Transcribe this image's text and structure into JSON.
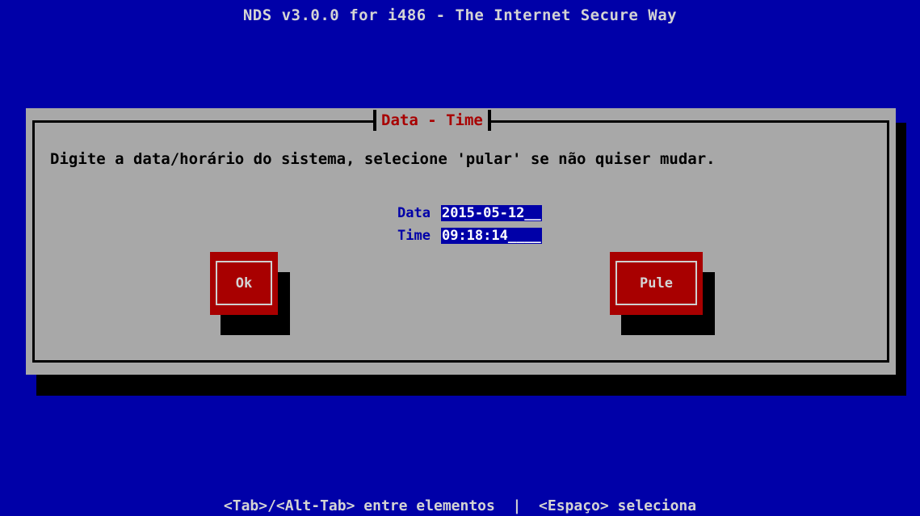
{
  "header": {
    "title": "NDS v3.0.0 for i486 - The Internet Secure Way"
  },
  "dialog": {
    "title": "Data - Time",
    "message": "Digite a data/horário do sistema, selecione 'pular' se não quiser mudar.",
    "fields": [
      {
        "label": "Data",
        "value": "2015-05-12__"
      },
      {
        "label": "Time",
        "value": "09:18:14____"
      }
    ],
    "buttons": {
      "ok_label": "Ok",
      "skip_label": "Pule"
    }
  },
  "footer": {
    "hint": "<Tab>/<Alt-Tab> entre elementos  |  <Espaço> seleciona"
  },
  "colors": {
    "screen_background": "#0000a8",
    "dialog_background": "#a8a8a8",
    "button_background": "#a80000",
    "title_accent": "#a80000"
  }
}
